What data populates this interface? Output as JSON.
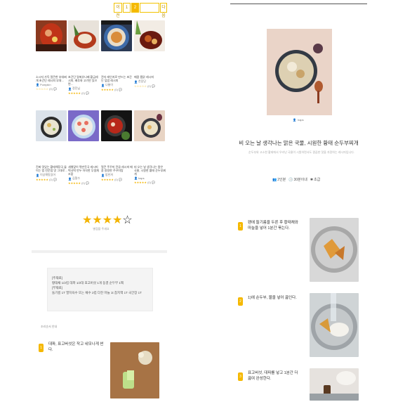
{
  "pagination": {
    "pages": [
      "이전",
      "1",
      "2",
      "",
      "다음"
    ],
    "active_index": 1
  },
  "grid_cards": [
    {
      "title": "소시지 가득 얼큰한 부대찌개 초간단 레시피 부대…",
      "author": "Pumpkin",
      "stars": 0,
      "count": "(0)"
    },
    {
      "title": "초간단 밀푀유나베 황금레시피, 배추와 고기만 있으면…",
      "author": "정진님",
      "stars": 5,
      "count": "(0)"
    },
    {
      "title": "전자 레인지로 만드는 초간단 덮밥 레시피",
      "author": "나롱이",
      "stars": 5,
      "count": "(0)"
    },
    {
      "title": "매콤 찜닭 레시피",
      "author": "찬장당",
      "stars": 0,
      "count": "(0)"
    },
    {
      "title": "진짜 맛있는 황태해장국 끓이는 법 전문점 맛 그대로…",
      "author": "이상해맛있어",
      "stars": 5,
      "count": "(0)"
    },
    {
      "title": "새해맞이 떡만둣국 레시피 떡국떡 만두 아삭한 무생채 조합",
      "author": "김철수",
      "stars": 5,
      "count": "(0)"
    },
    {
      "title": "얼큰 주꾸미 전골 레시피 매콤 칼칼한 주꾸미탕",
      "author": "밥한끼",
      "stars": 5,
      "count": "(0)"
    },
    {
      "title": "비 오는 날 생각나는 맑은 국물, 시원한 황태 순두부찌개",
      "author": "haps",
      "stars": 5,
      "count": "(0)"
    }
  ],
  "rating_widget": {
    "stars_filled": 4,
    "stars_total": 5,
    "caption": "별점을 주세요"
  },
  "tips": {
    "lines": [
      "[주재료]",
      "황태채 1/2컵 대파 1/2대 표고버섯 1개 동결 순두부 1팩",
      "[부재료]",
      "들기름 1T 멸치육수 또는 채수 2컵 다진 마늘 1t 참치액 1T 국간장 1T"
    ]
  },
  "left_small_label": "조리순서 안내",
  "left_steps": [
    {
      "number": "1",
      "text": "대파, 표고버섯은 작고 네모나게 썬다."
    }
  ],
  "detail": {
    "author": "haps",
    "title": "비 오는 날 생각나는 맑은 국물, 시원한 황태 순두부찌개",
    "description": "순두부와 고소한 황태에서 우러난 국물이 시원하면서도 깔끔한 맛을 자랑하는 레시피입니다.",
    "servings": "2인분",
    "time": "30분이내",
    "difficulty": "초급"
  },
  "detail_steps": [
    {
      "number": "1",
      "text": "팬에 들기름을 두른 후 황태채와 마늘을 넣어 1분간 볶는다."
    },
    {
      "number": "2",
      "text": "1)에 순두부, 물을 넣어 끓인다."
    },
    {
      "number": "3",
      "text": "표고버섯, 대파를 넣고 1분간 더 끓여 완성한다."
    }
  ],
  "colors": {
    "accent": "#f5b800",
    "star": "#f3b400"
  }
}
